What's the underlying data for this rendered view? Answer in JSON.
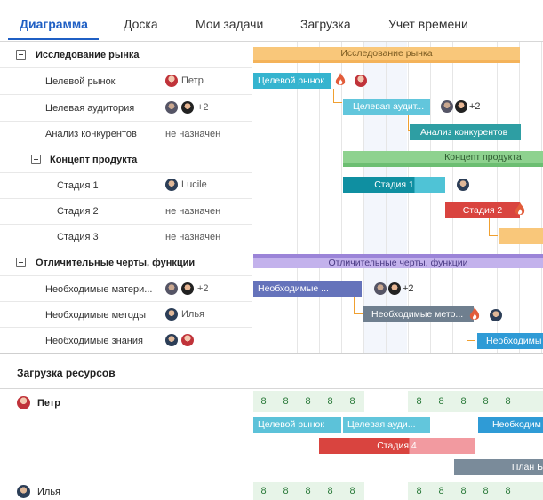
{
  "tabs": [
    "Диаграмма",
    "Доска",
    "Мои задачи",
    "Загрузка",
    "Учет времени"
  ],
  "tasks": {
    "group1": {
      "title": "Исследование рынка",
      "bar_label": "Исследование рынка"
    },
    "t1": {
      "label": "Целевой рынок",
      "assignee": "Петр",
      "bar_label": "Целевой рынок"
    },
    "t2": {
      "label": "Целевая аудитория",
      "assignee_more": "+2",
      "bar_label": "Целевая аудит..."
    },
    "t3": {
      "label": "Анализ конкурентов",
      "assignee": "не назначен",
      "bar_label": "Анализ конкурентов"
    },
    "group2": {
      "title": "Концепт продукта",
      "bar_label": "Концепт продукта"
    },
    "t4": {
      "label": "Стадия 1",
      "assignee": "Lucile",
      "bar_label": "Стадия 1"
    },
    "t5": {
      "label": "Стадия 2",
      "assignee": "не назначен",
      "bar_label": "Стадия 2"
    },
    "t6": {
      "label": "Стадия 3",
      "assignee": "не назначен"
    },
    "group3": {
      "title": "Отличительные черты, функции",
      "bar_label": "Отличительные черты, функции"
    },
    "t7": {
      "label": "Необходимые матери...",
      "assignee_more": "+2",
      "bar_label": "Необходимые ..."
    },
    "t8": {
      "label": "Необходимые методы",
      "assignee": "Илья",
      "bar_label": "Необходимые мето..."
    },
    "t9": {
      "label": "Необходимые знания",
      "bar_label": "Необходимы"
    }
  },
  "resources": {
    "title": "Загрузка ресурсов",
    "people": [
      {
        "name": "Петр",
        "hours": [
          "8",
          "8",
          "8",
          "8",
          "8",
          "",
          "",
          "8",
          "8",
          "8",
          "8",
          "8"
        ]
      },
      {
        "name": "Илья",
        "hours": [
          "8",
          "8",
          "8",
          "8",
          "8",
          "",
          "",
          "8",
          "8",
          "8",
          "8",
          "8"
        ]
      }
    ],
    "bars": {
      "r1": "Целевой рынок",
      "r2": "Целевая ауди...",
      "r3": "Необходим",
      "r4": "Стадия 4",
      "r5": "План Б"
    }
  },
  "colors": {
    "accent": "#1f5fc4",
    "orange": "#f5b75e",
    "cyan": "#35b4cf",
    "teal": "#2e9ea3",
    "green": "#7dc583",
    "darkteal": "#0f8fa1",
    "red": "#d9443f",
    "purple": "#9b84d8",
    "indigo": "#6573bb",
    "slate": "#6f7f8f",
    "blue": "#2f9bd6"
  }
}
